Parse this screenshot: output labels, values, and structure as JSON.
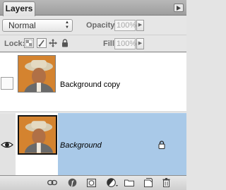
{
  "panel": {
    "tab_label": "Layers"
  },
  "blend_mode": {
    "value": "Normal"
  },
  "opacity": {
    "label": "Opacity:",
    "value": "100%"
  },
  "lock": {
    "label": "Lock:"
  },
  "fill": {
    "label": "Fill:",
    "value": "100%"
  },
  "layers": [
    {
      "name": "Background copy",
      "visible": false,
      "selected": false,
      "locked": false
    },
    {
      "name": "Background",
      "visible": true,
      "selected": true,
      "locked": true
    }
  ],
  "colors": {
    "selected_row": "#a8c8e8",
    "panel_bg": "#e4e4e4"
  },
  "icons": {
    "panel_menu": "triangle-right-icon",
    "lock_transparent": "checkerboard-icon",
    "lock_image": "brush-icon",
    "lock_position": "move-arrows-icon",
    "lock_all": "padlock-icon",
    "visibility": "eye-icon",
    "layer_lock": "padlock-icon",
    "bottom": [
      "link-icon",
      "layer-style-icon",
      "mask-icon",
      "adjustment-icon",
      "folder-icon",
      "new-layer-icon",
      "trash-icon"
    ]
  }
}
